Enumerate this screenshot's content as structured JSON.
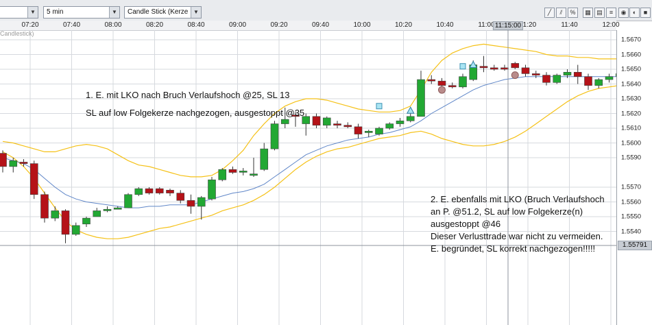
{
  "toolbar": {
    "instrument_value": "",
    "interval_value": "5 min",
    "charttype_value": "Candle Stick (Kerze"
  },
  "chart_label": "Candlestick)",
  "time_axis": [
    "07:20",
    "07:40",
    "08:00",
    "08:20",
    "08:40",
    "09:00",
    "09:20",
    "09:40",
    "10:00",
    "10:20",
    "10:40",
    "11:00",
    "11:20",
    "11:40",
    "12:00"
  ],
  "cursor": {
    "time": "11:15:00",
    "price": "1.55791"
  },
  "price_axis": [
    "1.5670",
    "1.5660",
    "1.5650",
    "1.5640",
    "1.5630",
    "1.5620",
    "1.5610",
    "1.5600",
    "1.5590",
    "1.5570",
    "1.5560",
    "1.5550",
    "1.5540"
  ],
  "annotations": {
    "note1_line1": "1. E. mit LKO nach Bruch Verlaufshoch @25, SL 13",
    "note1_line2": "SL auf low Folgekerze nachgezogen, ausgestoppt  @35",
    "note2_line1": "2. E. ebenfalls mit LKO (Bruch Verlaufshoch",
    "note2_line2": "an P. @51.2, SL auf low Folgekerze(n)",
    "note2_line3": "ausgestoppt @46",
    "note2_line4": "Dieser Verlusttrade war nicht zu vermeiden.",
    "note2_line5": "E. begründet, SL korrekt nachgezogen!!!!!"
  },
  "colors": {
    "up": "#22a833",
    "down": "#b51218",
    "band": "#f5c116",
    "ma": "#5f86c8",
    "grid": "#d6d9de"
  },
  "chart_data": {
    "type": "candlestick",
    "interval": "5 min",
    "candles": [
      {
        "o": 1.5593,
        "h": 1.5595,
        "l": 1.558,
        "c": 1.5584
      },
      {
        "o": 1.5584,
        "h": 1.559,
        "l": 1.558,
        "c": 1.5588
      },
      {
        "o": 1.5587,
        "h": 1.5589,
        "l": 1.5584,
        "c": 1.5586
      },
      {
        "o": 1.5586,
        "h": 1.5588,
        "l": 1.5562,
        "c": 1.5565
      },
      {
        "o": 1.5565,
        "h": 1.5567,
        "l": 1.5546,
        "c": 1.5549
      },
      {
        "o": 1.5549,
        "h": 1.5557,
        "l": 1.5547,
        "c": 1.5554
      },
      {
        "o": 1.5554,
        "h": 1.5555,
        "l": 1.5532,
        "c": 1.5538
      },
      {
        "o": 1.5538,
        "h": 1.5546,
        "l": 1.5537,
        "c": 1.5544
      },
      {
        "o": 1.5545,
        "h": 1.555,
        "l": 1.5543,
        "c": 1.5549
      },
      {
        "o": 1.555,
        "h": 1.5556,
        "l": 1.555,
        "c": 1.5554
      },
      {
        "o": 1.5554,
        "h": 1.5557,
        "l": 1.5553,
        "c": 1.5555
      },
      {
        "o": 1.5555,
        "h": 1.5557,
        "l": 1.5555,
        "c": 1.5556
      },
      {
        "o": 1.5556,
        "h": 1.5566,
        "l": 1.5556,
        "c": 1.5565
      },
      {
        "o": 1.5565,
        "h": 1.557,
        "l": 1.5564,
        "c": 1.5569
      },
      {
        "o": 1.5569,
        "h": 1.557,
        "l": 1.5565,
        "c": 1.5566
      },
      {
        "o": 1.5569,
        "h": 1.557,
        "l": 1.5565,
        "c": 1.5566
      },
      {
        "o": 1.5568,
        "h": 1.5569,
        "l": 1.5564,
        "c": 1.5566
      },
      {
        "o": 1.5566,
        "h": 1.5568,
        "l": 1.5559,
        "c": 1.5561
      },
      {
        "o": 1.5561,
        "h": 1.5565,
        "l": 1.5552,
        "c": 1.5557
      },
      {
        "o": 1.5557,
        "h": 1.5564,
        "l": 1.5548,
        "c": 1.5563
      },
      {
        "o": 1.5562,
        "h": 1.5577,
        "l": 1.5561,
        "c": 1.5575
      },
      {
        "o": 1.5575,
        "h": 1.5583,
        "l": 1.5574,
        "c": 1.5582
      },
      {
        "o": 1.5582,
        "h": 1.5584,
        "l": 1.5579,
        "c": 1.558
      },
      {
        "o": 1.5581,
        "h": 1.5583,
        "l": 1.5578,
        "c": 1.5581
      },
      {
        "o": 1.5578,
        "h": 1.559,
        "l": 1.5577,
        "c": 1.5579
      },
      {
        "o": 1.5582,
        "h": 1.56,
        "l": 1.5581,
        "c": 1.5596
      },
      {
        "o": 1.5596,
        "h": 1.5615,
        "l": 1.5595,
        "c": 1.5613
      },
      {
        "o": 1.5613,
        "h": 1.5624,
        "l": 1.561,
        "c": 1.5616
      },
      {
        "o": 1.5619,
        "h": 1.5621,
        "l": 1.5611,
        "c": 1.5618
      },
      {
        "o": 1.5613,
        "h": 1.562,
        "l": 1.5605,
        "c": 1.5618
      },
      {
        "o": 1.5618,
        "h": 1.562,
        "l": 1.561,
        "c": 1.5612
      },
      {
        "o": 1.5612,
        "h": 1.5618,
        "l": 1.561,
        "c": 1.5617
      },
      {
        "o": 1.5613,
        "h": 1.5615,
        "l": 1.561,
        "c": 1.5612
      },
      {
        "o": 1.5612,
        "h": 1.5614,
        "l": 1.561,
        "c": 1.5611
      },
      {
        "o": 1.5611,
        "h": 1.5613,
        "l": 1.5603,
        "c": 1.5606
      },
      {
        "o": 1.5607,
        "h": 1.5609,
        "l": 1.5604,
        "c": 1.5608
      },
      {
        "o": 1.5606,
        "h": 1.5611,
        "l": 1.5605,
        "c": 1.561
      },
      {
        "o": 1.561,
        "h": 1.5614,
        "l": 1.5609,
        "c": 1.5613
      },
      {
        "o": 1.5613,
        "h": 1.5617,
        "l": 1.5611,
        "c": 1.5615
      },
      {
        "o": 1.5615,
        "h": 1.562,
        "l": 1.5614,
        "c": 1.5618
      },
      {
        "o": 1.5618,
        "h": 1.5649,
        "l": 1.5618,
        "c": 1.5643
      },
      {
        "o": 1.5643,
        "h": 1.5646,
        "l": 1.564,
        "c": 1.5642
      },
      {
        "o": 1.5642,
        "h": 1.5644,
        "l": 1.5637,
        "c": 1.5639
      },
      {
        "o": 1.5639,
        "h": 1.5641,
        "l": 1.5637,
        "c": 1.5638
      },
      {
        "o": 1.5638,
        "h": 1.5647,
        "l": 1.5637,
        "c": 1.5645
      },
      {
        "o": 1.5643,
        "h": 1.5656,
        "l": 1.5642,
        "c": 1.5653
      },
      {
        "o": 1.5652,
        "h": 1.5659,
        "l": 1.5648,
        "c": 1.5651
      },
      {
        "o": 1.5651,
        "h": 1.5653,
        "l": 1.5649,
        "c": 1.565
      },
      {
        "o": 1.5651,
        "h": 1.5653,
        "l": 1.5649,
        "c": 1.565
      },
      {
        "o": 1.5654,
        "h": 1.5655,
        "l": 1.565,
        "c": 1.5651
      },
      {
        "o": 1.5651,
        "h": 1.5653,
        "l": 1.5645,
        "c": 1.5647
      },
      {
        "o": 1.5647,
        "h": 1.5649,
        "l": 1.5644,
        "c": 1.5646
      },
      {
        "o": 1.5646,
        "h": 1.5648,
        "l": 1.5639,
        "c": 1.5641
      },
      {
        "o": 1.5641,
        "h": 1.5647,
        "l": 1.564,
        "c": 1.5646
      },
      {
        "o": 1.5646,
        "h": 1.565,
        "l": 1.5644,
        "c": 1.5648
      },
      {
        "o": 1.5648,
        "h": 1.5653,
        "l": 1.564,
        "c": 1.5645
      },
      {
        "o": 1.5645,
        "h": 1.5647,
        "l": 1.5636,
        "c": 1.5639
      },
      {
        "o": 1.5639,
        "h": 1.5644,
        "l": 1.5637,
        "c": 1.5643
      },
      {
        "o": 1.5643,
        "h": 1.5647,
        "l": 1.5641,
        "c": 1.5645
      },
      {
        "o": 1.5645,
        "h": 1.5649,
        "l": 1.5643,
        "c": 1.5647
      }
    ],
    "markers": [
      {
        "type": "square",
        "idx": 36,
        "price": 1.5625
      },
      {
        "type": "triangle",
        "idx": 39,
        "price": 1.5622
      },
      {
        "type": "circle",
        "idx": 42,
        "price": 1.5636
      },
      {
        "type": "square",
        "idx": 44,
        "price": 1.5652
      },
      {
        "type": "triangle",
        "idx": 45,
        "price": 1.5653
      },
      {
        "type": "circle",
        "idx": 49,
        "price": 1.5646
      }
    ],
    "upper_band": [
      1.5601,
      1.56,
      1.5598,
      1.5596,
      1.5594,
      1.5594,
      1.5596,
      1.5598,
      1.5599,
      1.5598,
      1.5596,
      1.5592,
      1.5588,
      1.5585,
      1.5584,
      1.5582,
      1.558,
      1.5578,
      1.5577,
      1.5577,
      1.5578,
      1.5582,
      1.5588,
      1.5595,
      1.5605,
      1.5613,
      1.562,
      1.5625,
      1.5628,
      1.563,
      1.563,
      1.5629,
      1.5627,
      1.5625,
      1.5623,
      1.5622,
      1.5621,
      1.5621,
      1.5622,
      1.5625,
      1.5636,
      1.5648,
      1.5656,
      1.5661,
      1.5664,
      1.5666,
      1.5667,
      1.5666,
      1.5665,
      1.5664,
      1.5663,
      1.5662,
      1.566,
      1.5659,
      1.5659,
      1.5658,
      1.5658,
      1.5657,
      1.5657,
      1.5657
    ],
    "lower_band": [
      1.5594,
      1.559,
      1.5584,
      1.5576,
      1.5566,
      1.5556,
      1.5547,
      1.5541,
      1.5538,
      1.5536,
      1.5535,
      1.5535,
      1.5536,
      1.5538,
      1.554,
      1.5542,
      1.5543,
      1.5545,
      1.5547,
      1.5549,
      1.5551,
      1.5554,
      1.5556,
      1.5558,
      1.5561,
      1.5565,
      1.557,
      1.5576,
      1.5582,
      1.5587,
      1.5591,
      1.5594,
      1.5596,
      1.5597,
      1.5599,
      1.5601,
      1.5603,
      1.5604,
      1.5605,
      1.5607,
      1.5608,
      1.5606,
      1.5603,
      1.5601,
      1.5599,
      1.5598,
      1.5598,
      1.5599,
      1.5601,
      1.5604,
      1.5608,
      1.5613,
      1.5618,
      1.5623,
      1.5628,
      1.5632,
      1.5635,
      1.5637,
      1.5638,
      1.5639
    ],
    "ma": [
      1.559,
      1.5588,
      1.5586,
      1.5582,
      1.5576,
      1.557,
      1.5565,
      1.5562,
      1.556,
      1.5559,
      1.5558,
      1.5557,
      1.5556,
      1.5556,
      1.5557,
      1.5557,
      1.5558,
      1.5558,
      1.5558,
      1.556,
      1.5562,
      1.5564,
      1.5566,
      1.5567,
      1.5569,
      1.5572,
      1.5577,
      1.5582,
      1.5587,
      1.5592,
      1.5595,
      1.5598,
      1.56,
      1.5602,
      1.5603,
      1.5604,
      1.5606,
      1.5607,
      1.5609,
      1.5611,
      1.5615,
      1.562,
      1.5624,
      1.5628,
      1.5632,
      1.5636,
      1.5639,
      1.5641,
      1.5643,
      1.5644,
      1.5645,
      1.5645,
      1.5645,
      1.5645,
      1.5645,
      1.5645,
      1.5645,
      1.5645,
      1.5645,
      1.5645
    ]
  }
}
